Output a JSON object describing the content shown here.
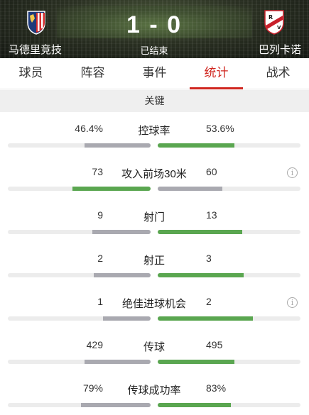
{
  "match": {
    "home_team": "马德里竞技",
    "away_team": "巴列卡诺",
    "score": "1 - 0",
    "status": "已结束",
    "home_logo": "atletico-madrid-crest-icon",
    "away_logo": "rayo-vallecano-crest-icon"
  },
  "tabs": [
    "球员",
    "阵容",
    "事件",
    "统计",
    "战术"
  ],
  "active_tab": "统计",
  "section_title": "关键",
  "colors": {
    "accent": "#d0261f",
    "winner_bar": "#5aa650",
    "loser_bar": "#a9a9b0"
  },
  "stats": [
    {
      "label": "控球率",
      "home": "46.4%",
      "away": "53.6%",
      "home_share": 0.464,
      "away_share": 0.536,
      "info": false
    },
    {
      "label": "攻入前场30米",
      "home": "73",
      "away": "60",
      "home_share": 0.549,
      "away_share": 0.451,
      "info": true
    },
    {
      "label": "射门",
      "home": "9",
      "away": "13",
      "home_share": 0.409,
      "away_share": 0.591,
      "info": false
    },
    {
      "label": "射正",
      "home": "2",
      "away": "3",
      "home_share": 0.4,
      "away_share": 0.6,
      "info": false
    },
    {
      "label": "绝佳进球机会",
      "home": "1",
      "away": "2",
      "home_share": 0.333,
      "away_share": 0.667,
      "info": true
    },
    {
      "label": "传球",
      "home": "429",
      "away": "495",
      "home_share": 0.464,
      "away_share": 0.536,
      "info": false
    },
    {
      "label": "传球成功率",
      "home": "79%",
      "away": "83%",
      "home_share": 0.488,
      "away_share": 0.512,
      "info": false
    }
  ]
}
